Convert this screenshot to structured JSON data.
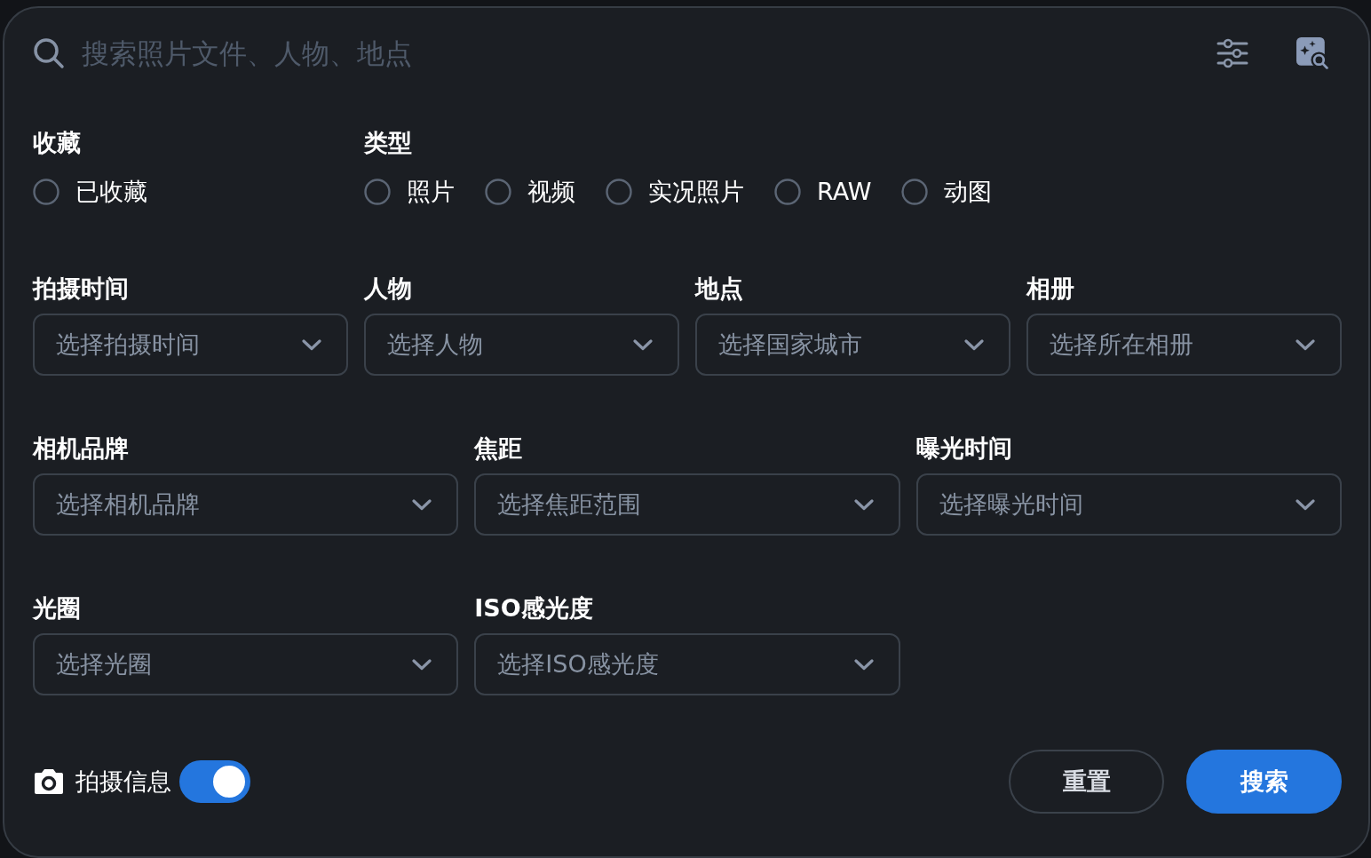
{
  "search": {
    "placeholder": "搜索照片文件、人物、地点"
  },
  "choice_groups": [
    {
      "label": "收藏",
      "options": [
        {
          "label": "已收藏",
          "checked": false
        }
      ]
    },
    {
      "label": "类型",
      "options": [
        {
          "label": "照片",
          "checked": false
        },
        {
          "label": "视频",
          "checked": false
        },
        {
          "label": "实况照片",
          "checked": false
        },
        {
          "label": "RAW",
          "checked": false
        },
        {
          "label": "动图",
          "checked": false
        }
      ]
    }
  ],
  "filter_rows": [
    {
      "filters": [
        {
          "label": "拍摄时间",
          "placeholder": "选择拍摄时间"
        },
        {
          "label": "人物",
          "placeholder": "选择人物"
        },
        {
          "label": "地点",
          "placeholder": "选择国家城市"
        },
        {
          "label": "相册",
          "placeholder": "选择所在相册"
        }
      ]
    },
    {
      "filters": [
        {
          "label": "相机品牌",
          "placeholder": "选择相机品牌"
        },
        {
          "label": "焦距",
          "placeholder": "选择焦距范围"
        },
        {
          "label": "曝光时间",
          "placeholder": "选择曝光时间"
        }
      ]
    },
    {
      "filters": [
        {
          "label": "光圈",
          "placeholder": "选择光圈"
        },
        {
          "label": "ISO感光度",
          "placeholder": "选择ISO感光度"
        }
      ]
    }
  ],
  "shot_info": {
    "label": "拍摄信息",
    "on": true
  },
  "buttons": [
    {
      "label": "重置",
      "kind": "secondary"
    },
    {
      "label": "搜索",
      "kind": "primary"
    }
  ]
}
